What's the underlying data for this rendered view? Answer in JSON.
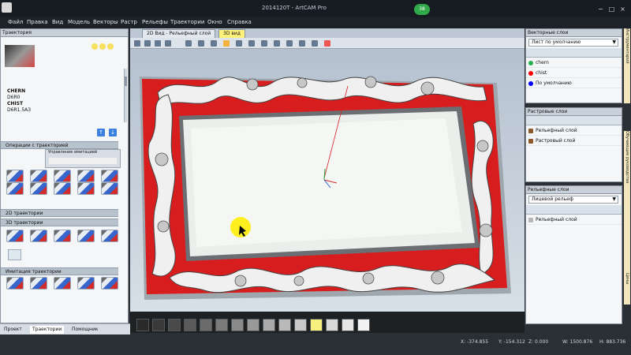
{
  "window": {
    "title": "2014120T - ArtCAM Pro",
    "center_badge": "38"
  },
  "menu": [
    "Файл",
    "Правка",
    "Вид",
    "Модель",
    "Векторы",
    "Растр",
    "Рельефы",
    "Траектории",
    "Окно",
    "Справка"
  ],
  "left_panel": {
    "title": "Траектория",
    "list": [
      "CHERN",
      "D6R0",
      "CHIST",
      "D6R1.5A3"
    ],
    "operations_header": "Операции с траекторией",
    "simulation_header": "Управление имитацией",
    "sections": [
      "2D траектории",
      "3D траектории",
      "Имитация траектории"
    ],
    "tabs": [
      "Проект",
      "Траектории",
      "Помощник"
    ]
  },
  "main_tabs": [
    "2D Вид - Рельефный слой",
    "3D вид"
  ],
  "right_panels": {
    "vector": {
      "title": "Векторные слои",
      "dropdown": "Лист по умолчанию",
      "layers": [
        "chern",
        "chist",
        "По умолчанию"
      ],
      "colors": [
        "#22b14c",
        "#ff0000",
        "#0000ff"
      ]
    },
    "raster": {
      "title": "Растровые слои",
      "layers": [
        "Рельефный слой",
        "Растровый слой"
      ]
    },
    "relief": {
      "title": "Рельефные слои",
      "dropdown": "Лицевой рельеф",
      "layers": [
        "Рельефный слой"
      ]
    },
    "rail_labels": [
      "Инструментарий",
      "Обучающие руководства",
      "Цены"
    ]
  },
  "status": {
    "x": "X: -374.855",
    "y": "Y: -154.312",
    "z": "Z: 0.000",
    "w": "W: 1500.876",
    "h": "H: 883.736"
  },
  "palette": {
    "colors": [
      "#2a2a2a",
      "#3a3a3a",
      "#4a4a4a",
      "#5b5b5b",
      "#6b6b6b",
      "#7a7a7a",
      "#8a8a8a",
      "#999999",
      "#aaaaaa",
      "#b9b9b9",
      "#c9c9c9",
      "#f6f07f",
      "#d8d8d8",
      "#e6e6e6",
      "#f2f2f2"
    ]
  }
}
